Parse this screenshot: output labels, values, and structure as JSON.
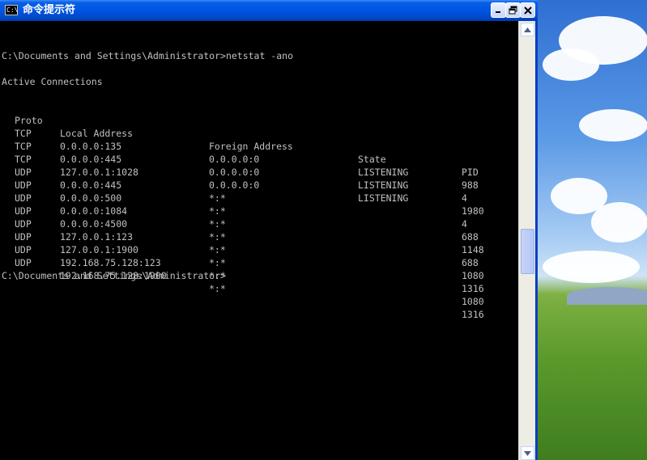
{
  "window": {
    "title": "命令提示符",
    "icon_text": "C:\\",
    "buttons": [
      "minimize",
      "maximize",
      "close"
    ]
  },
  "console": {
    "command_line": "C:\\Documents and Settings\\Administrator>netstat -ano",
    "heading": "Active Connections",
    "columns": [
      "Proto",
      "Local Address",
      "Foreign Address",
      "State",
      "PID"
    ],
    "rows": [
      {
        "proto": "TCP",
        "local": "0.0.0.0:135",
        "foreign": "0.0.0.0:0",
        "state": "LISTENING",
        "pid": "988"
      },
      {
        "proto": "TCP",
        "local": "0.0.0.0:445",
        "foreign": "0.0.0.0:0",
        "state": "LISTENING",
        "pid": "4"
      },
      {
        "proto": "TCP",
        "local": "127.0.0.1:1028",
        "foreign": "0.0.0.0:0",
        "state": "LISTENING",
        "pid": "1980"
      },
      {
        "proto": "UDP",
        "local": "0.0.0.0:445",
        "foreign": "*:*",
        "state": "",
        "pid": "4"
      },
      {
        "proto": "UDP",
        "local": "0.0.0.0:500",
        "foreign": "*:*",
        "state": "",
        "pid": "688"
      },
      {
        "proto": "UDP",
        "local": "0.0.0.0:1084",
        "foreign": "*:*",
        "state": "",
        "pid": "1148"
      },
      {
        "proto": "UDP",
        "local": "0.0.0.0:4500",
        "foreign": "*:*",
        "state": "",
        "pid": "688"
      },
      {
        "proto": "UDP",
        "local": "127.0.0.1:123",
        "foreign": "*:*",
        "state": "",
        "pid": "1080"
      },
      {
        "proto": "UDP",
        "local": "127.0.0.1:1900",
        "foreign": "*:*",
        "state": "",
        "pid": "1316"
      },
      {
        "proto": "UDP",
        "local": "192.168.75.128:123",
        "foreign": "*:*",
        "state": "",
        "pid": "1080"
      },
      {
        "proto": "UDP",
        "local": "192.168.75.128:1900",
        "foreign": "*:*",
        "state": "",
        "pid": "1316"
      }
    ],
    "prompt": "C:\\Documents and Settings\\Administrator>"
  },
  "colors": {
    "console_bg": "#000000",
    "console_fg": "#c0c0c0",
    "titlebar": "#0054e3",
    "close_button": "#e0e8ff"
  }
}
